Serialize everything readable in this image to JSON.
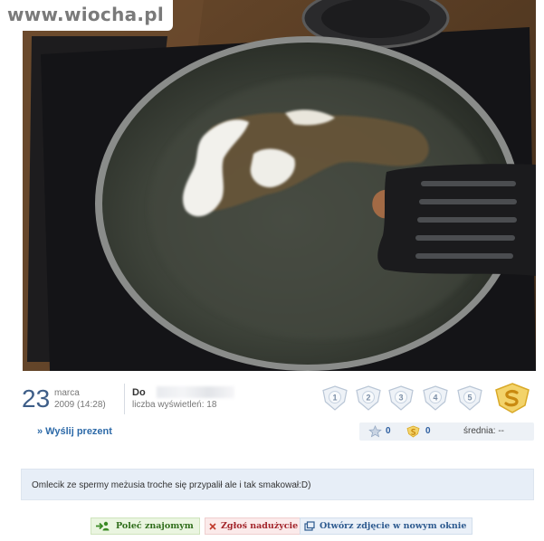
{
  "watermark": {
    "text": "www.wiocha.pl"
  },
  "photo": {
    "icon": "frying-pan-photo"
  },
  "meta": {
    "day": "23",
    "month": "marca",
    "datetime": "2009 (14:28)",
    "author_visible": "Do",
    "views_label": "liczba wyświetleń: 18"
  },
  "rating": {
    "stars": [
      "1",
      "2",
      "3",
      "4",
      "5"
    ],
    "super_icon": "super-badge-icon"
  },
  "actions": {
    "gift_label": "» Wyślij prezent"
  },
  "stats": {
    "star_count": "0",
    "super_count": "0",
    "average_label": "średnia: --"
  },
  "description": {
    "text": "Omlecik ze spermy meżusia troche się przypalił ale i tak smakował:D)"
  },
  "buttons": {
    "recommend": "Poleć znajomym",
    "report": "Zgłoś nadużycie",
    "open": "Otwórz zdjęcie w nowym oknie"
  },
  "colors": {
    "accent": "#2d6aa8",
    "date": "#3e5e88",
    "panel": "#e7eef7"
  }
}
